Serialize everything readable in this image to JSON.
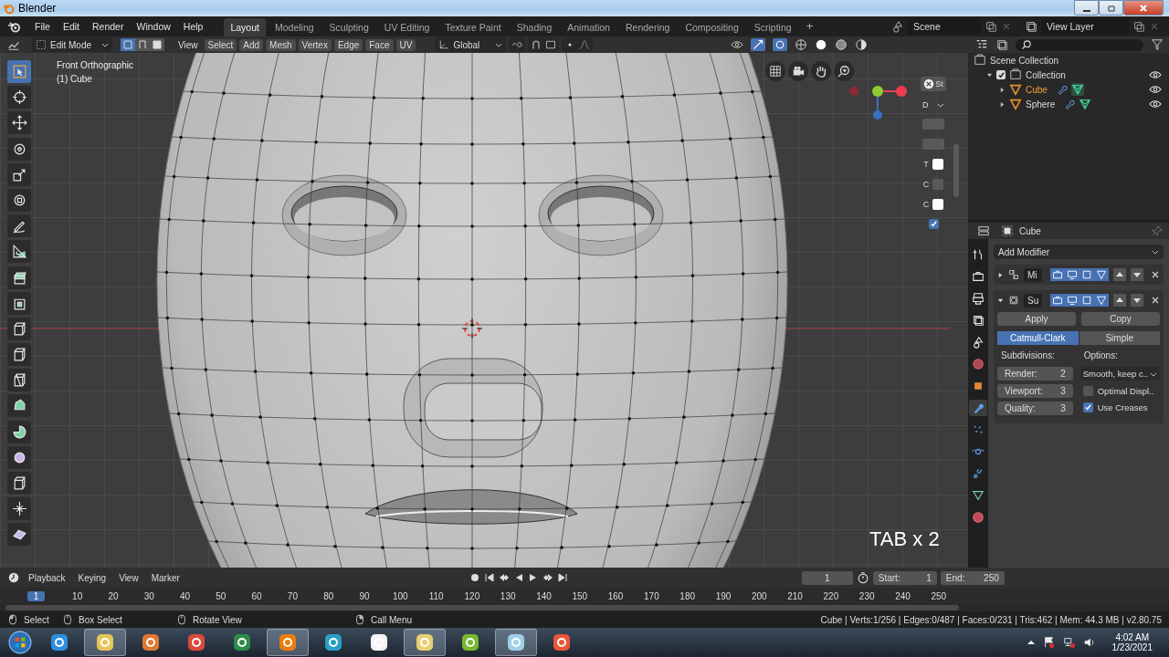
{
  "window": {
    "title": "Blender"
  },
  "menu": [
    "File",
    "Edit",
    "Render",
    "Window",
    "Help"
  ],
  "workspaces": [
    {
      "label": "Layout",
      "selected": true
    },
    {
      "label": "Modeling",
      "selected": false
    },
    {
      "label": "Sculpting",
      "selected": false
    },
    {
      "label": "UV Editing",
      "selected": false
    },
    {
      "label": "Texture Paint",
      "selected": false
    },
    {
      "label": "Shading",
      "selected": false
    },
    {
      "label": "Animation",
      "selected": false
    },
    {
      "label": "Rendering",
      "selected": false
    },
    {
      "label": "Compositing",
      "selected": false
    },
    {
      "label": "Scripting",
      "selected": false
    }
  ],
  "add_workspace": "+",
  "scene": "Scene",
  "view_layer": "View Layer",
  "viewport_header": {
    "mode": "Edit Mode",
    "select_modes": [
      {
        "selected": true
      },
      {
        "selected": false
      },
      {
        "selected": false
      }
    ],
    "view_menu": "View",
    "menus": [
      "Select",
      "Add",
      "Mesh",
      "Vertex",
      "Edge",
      "Face",
      "UV"
    ],
    "orientation": "Global"
  },
  "viewport": {
    "view_name": "Front Orthographic",
    "object_name": "(1) Cube",
    "caption": "TAB x 2"
  },
  "toolbar": [
    {
      "kind": "select",
      "selected": true
    },
    {
      "kind": "cursor",
      "selected": false
    },
    {
      "kind": "move",
      "selected": false
    },
    {
      "kind": "rotate",
      "selected": false
    },
    {
      "kind": "scale",
      "selected": false
    },
    {
      "kind": "transform",
      "selected": false
    },
    {
      "kind": "annotate",
      "selected": false
    },
    {
      "kind": "measure",
      "selected": false
    },
    {
      "kind": "extrude",
      "selected": false
    },
    {
      "kind": "inset",
      "selected": false
    },
    {
      "kind": "cube",
      "selected": false
    },
    {
      "kind": "cube",
      "selected": false
    },
    {
      "kind": "knife",
      "selected": false
    },
    {
      "kind": "polybuild",
      "selected": false
    },
    {
      "kind": "spin",
      "selected": false
    },
    {
      "kind": "smooth",
      "selected": false
    },
    {
      "kind": "cube",
      "selected": false
    },
    {
      "kind": "shrink",
      "selected": false
    },
    {
      "kind": "shear",
      "selected": false
    }
  ],
  "n_panel": {
    "button": "St",
    "dropdown": "D",
    "rows": [
      {
        "label": "T"
      },
      {
        "label": "C"
      },
      {
        "label": "C"
      }
    ],
    "checkbox": {
      "checked": true
    }
  },
  "outliner": {
    "tree": [
      {
        "kind": "scene_collection",
        "label": "Scene Collection",
        "selected": false,
        "children": [
          {
            "kind": "collection",
            "label": "Collection",
            "expanded": true,
            "checked": true,
            "selected": false,
            "children": [
              {
                "kind": "object",
                "label": "Cube",
                "expanded": false,
                "selected": true
              },
              {
                "kind": "object",
                "label": "Sphere",
                "expanded": false,
                "selected": false
              }
            ]
          }
        ]
      }
    ]
  },
  "properties": {
    "object": "Cube",
    "tabs": [
      {
        "kind": "tool",
        "selected": false
      },
      {
        "kind": "render",
        "selected": false
      },
      {
        "kind": "output",
        "selected": false
      },
      {
        "kind": "viewlayer",
        "selected": false
      },
      {
        "kind": "scene",
        "selected": false
      },
      {
        "kind": "world",
        "selected": false
      },
      {
        "kind": "object",
        "selected": false
      },
      {
        "kind": "modifier",
        "selected": true
      },
      {
        "kind": "particles",
        "selected": false
      },
      {
        "kind": "physics",
        "selected": false
      },
      {
        "kind": "constraints",
        "selected": false
      },
      {
        "kind": "data",
        "selected": false
      },
      {
        "kind": "material",
        "selected": false
      }
    ],
    "add_modifier": "Add Modifier",
    "modifiers": [
      {
        "kind": "mirror",
        "name": "Mi",
        "expanded": false,
        "toggles": [
          {
            "on": true
          },
          {
            "on": true
          },
          {
            "on": true
          },
          {
            "on": true
          }
        ]
      },
      {
        "kind": "subsurf",
        "name": "Su",
        "expanded": true,
        "toggles": [
          {
            "on": true
          },
          {
            "on": true
          },
          {
            "on": true
          },
          {
            "on": true
          }
        ]
      }
    ],
    "apply": "Apply",
    "copy": "Copy",
    "algorithms": [
      {
        "label": "Catmull-Clark",
        "selected": true
      },
      {
        "label": "Simple",
        "selected": false
      }
    ],
    "subdivisions_label": "Subdivisions:",
    "fields": [
      {
        "label": "Render:",
        "value": "2"
      },
      {
        "label": "Viewport:",
        "value": "3"
      },
      {
        "label": "Quality:",
        "value": "3"
      }
    ],
    "options_label": "Options:",
    "uv_smooth": "Smooth, keep c..",
    "options": [
      {
        "label": "Optimal Displ..",
        "checked": false
      },
      {
        "label": "Use Creases",
        "checked": true
      }
    ]
  },
  "timeline": {
    "menus": [
      "Playback",
      "Keying",
      "View",
      "Marker"
    ],
    "current_frame": "1",
    "start_label": "Start:",
    "start": "1",
    "end_label": "End:",
    "end": "250",
    "frames": [
      {
        "label": "1",
        "selected": true
      },
      {
        "label": "10",
        "selected": false
      },
      {
        "label": "20",
        "selected": false
      },
      {
        "label": "30",
        "selected": false
      },
      {
        "label": "40",
        "selected": false
      },
      {
        "label": "50",
        "selected": false
      },
      {
        "label": "60",
        "selected": false
      },
      {
        "label": "70",
        "selected": false
      },
      {
        "label": "80",
        "selected": false
      },
      {
        "label": "90",
        "selected": false
      },
      {
        "label": "100",
        "selected": false
      },
      {
        "label": "110",
        "selected": false
      },
      {
        "label": "120",
        "selected": false
      },
      {
        "label": "130",
        "selected": false
      },
      {
        "label": "140",
        "selected": false
      },
      {
        "label": "150",
        "selected": false
      },
      {
        "label": "160",
        "selected": false
      },
      {
        "label": "170",
        "selected": false
      },
      {
        "label": "180",
        "selected": false
      },
      {
        "label": "190",
        "selected": false
      },
      {
        "label": "200",
        "selected": false
      },
      {
        "label": "210",
        "selected": false
      },
      {
        "label": "220",
        "selected": false
      },
      {
        "label": "230",
        "selected": false
      },
      {
        "label": "240",
        "selected": false
      },
      {
        "label": "250",
        "selected": false
      }
    ]
  },
  "status_bar": {
    "hints": [
      {
        "kind": "left",
        "label": "Select"
      },
      {
        "kind": "drag",
        "label": "Box Select"
      },
      {
        "kind": "middle",
        "label": "Rotate View"
      },
      {
        "kind": "right",
        "label": "Call Menu"
      }
    ],
    "stats": "Cube | Verts:1/256 | Edges:0/487 | Faces:0/231 | Tris:462 | Mem: 44.3 MB | v2.80.75"
  },
  "taskbar": {
    "apps": [
      {
        "kind": "ie",
        "running": false
      },
      {
        "kind": "folder",
        "running": true
      },
      {
        "kind": "media",
        "running": false
      },
      {
        "kind": "chrome",
        "running": false
      },
      {
        "kind": "excel",
        "running": false
      },
      {
        "kind": "blender",
        "running": true
      },
      {
        "kind": "edge",
        "running": false
      },
      {
        "kind": "file",
        "running": false
      },
      {
        "kind": "notes",
        "running": true
      },
      {
        "kind": "torrent",
        "running": false
      },
      {
        "kind": "notepad",
        "running": true
      },
      {
        "kind": "recorder",
        "running": false
      }
    ],
    "time": "4:02 AM",
    "date": "1/23/2021"
  }
}
